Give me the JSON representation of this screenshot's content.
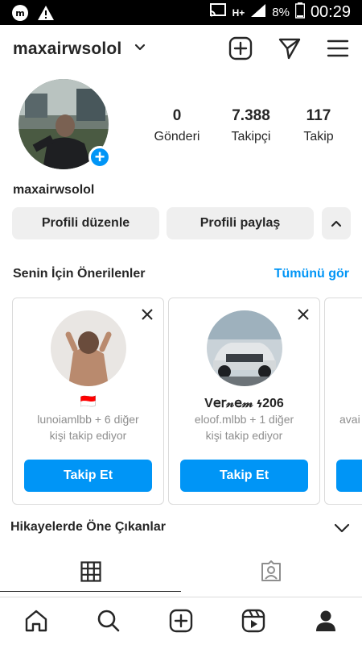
{
  "status_bar": {
    "network": "H+",
    "battery": "8%",
    "time": "00:29"
  },
  "header": {
    "username": "maxairwsolol"
  },
  "profile": {
    "stats": [
      {
        "value": "0",
        "label": "Gönderi"
      },
      {
        "value": "7.388",
        "label": "Takipçi"
      },
      {
        "value": "117",
        "label": "Takip"
      }
    ],
    "display_name": "maxairwsolol",
    "edit_label": "Profili düzenle",
    "share_label": "Profili paylaş"
  },
  "suggestions": {
    "title": "Senin İçin Önerilenler",
    "see_all": "Tümünü gör",
    "cards": [
      {
        "name": "🇮🇩",
        "line1": "lunoiamlbb + 6 diğer",
        "line2": "kişi takip ediyor",
        "follow": "Takip Et"
      },
      {
        "name": "V𝖾𝗋𝓃𝖾𝓂 𐓷206",
        "line1": "eloof.mlbb + 1 diğer",
        "line2": "kişi takip ediyor",
        "follow": "Takip Et"
      },
      {
        "name": "",
        "line1": "avai",
        "line2": "",
        "follow": ""
      }
    ]
  },
  "highlights": {
    "title": "Hikayelerde Öne Çıkanlar"
  },
  "colors": {
    "accent": "#0095f6",
    "text": "#262626",
    "muted": "#8e8e8e",
    "button_gray": "#efefef"
  }
}
